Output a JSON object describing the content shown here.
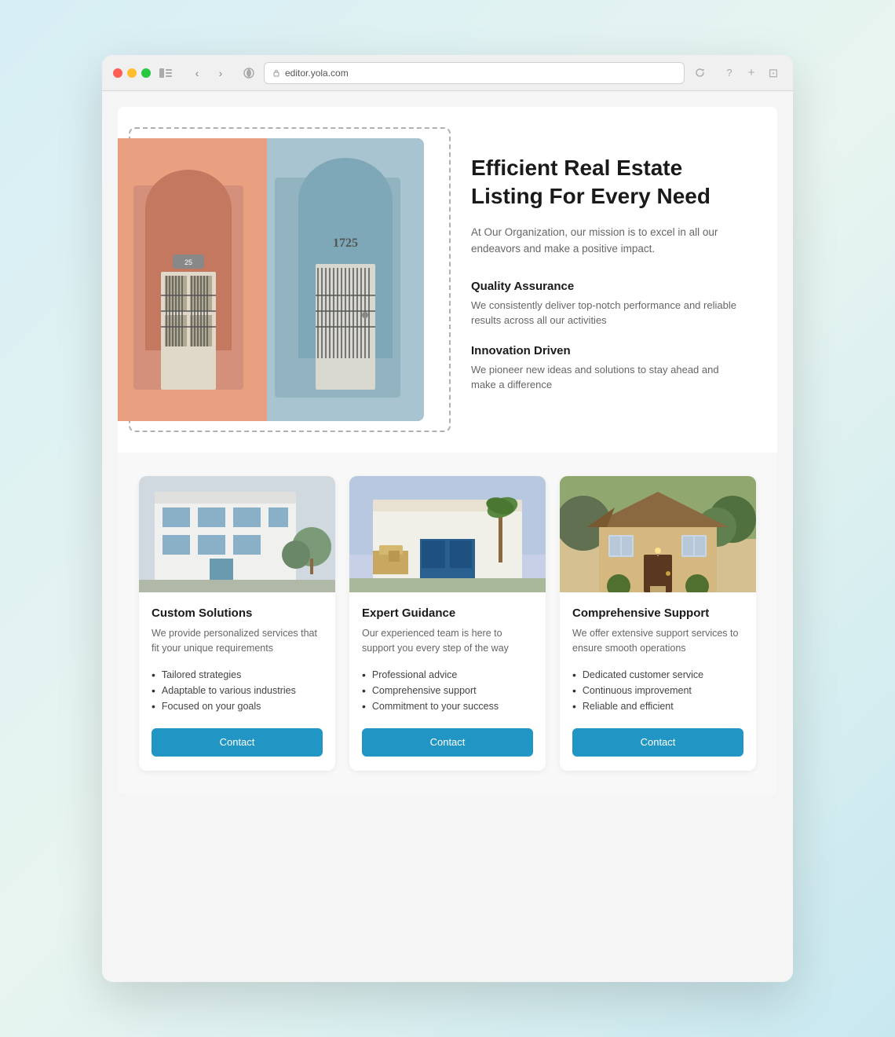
{
  "browser": {
    "url": "editor.yola.com",
    "tab_icon": "🌐"
  },
  "hero": {
    "title": "Efficient Real Estate Listing For Every Need",
    "subtitle": "At Our Organization, our mission is to excel in all our endeavors and make a positive impact.",
    "features": [
      {
        "title": "Quality Assurance",
        "desc": "We consistently deliver top-notch performance and reliable results across all our activities"
      },
      {
        "title": "Innovation Driven",
        "desc": "We pioneer new ideas and solutions to stay ahead and make a difference"
      }
    ]
  },
  "cards": [
    {
      "title": "Custom Solutions",
      "desc": "We provide personalized services that fit your unique requirements",
      "list": [
        "Tailored strategies",
        "Adaptable to various industries",
        "Focused on your goals"
      ],
      "button": "Contact"
    },
    {
      "title": "Expert Guidance",
      "desc": "Our experienced team is here to support you every step of the way",
      "list": [
        "Professional advice",
        "Comprehensive support",
        "Commitment to your success"
      ],
      "button": "Contact"
    },
    {
      "title": "Comprehensive Support",
      "desc": "We offer extensive support services to ensure smooth operations",
      "list": [
        "Dedicated customer service",
        "Continuous improvement",
        "Reliable and efficient"
      ],
      "button": "Contact"
    }
  ]
}
